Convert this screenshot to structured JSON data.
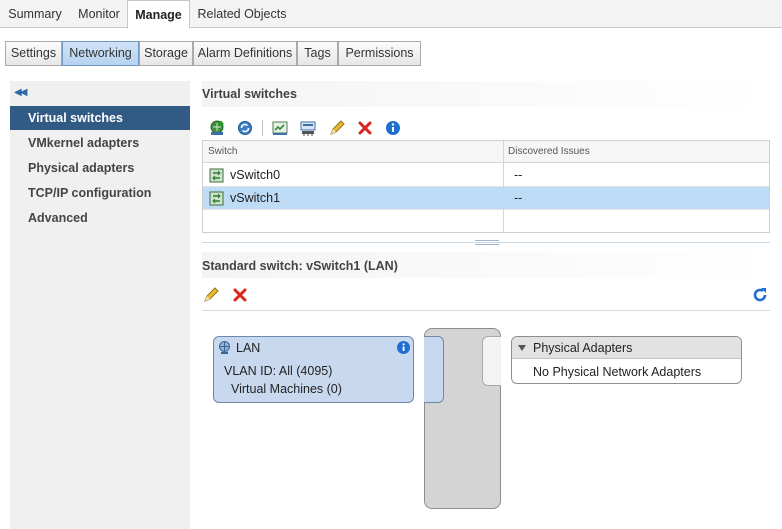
{
  "top_tabs": [
    "Summary",
    "Monitor",
    "Manage",
    "Related Objects"
  ],
  "sub_tabs": [
    "Settings",
    "Networking",
    "Storage",
    "Alarm Definitions",
    "Tags",
    "Permissions"
  ],
  "nav": {
    "collapse_glyph": "◀◀",
    "items": [
      "Virtual switches",
      "VMkernel adapters",
      "Physical adapters",
      "TCP/IP configuration",
      "Advanced"
    ]
  },
  "virtual_switches": {
    "title": "Virtual switches",
    "columns": [
      "Switch",
      "Discovered Issues"
    ],
    "rows": [
      {
        "switch": "vSwitch0",
        "issues": "--"
      },
      {
        "switch": "vSwitch1",
        "issues": "--"
      }
    ]
  },
  "detail": {
    "title": "Standard switch: vSwitch1 (LAN)",
    "portgroup": {
      "name": "LAN",
      "vlan": "VLAN ID: All (4095)",
      "vms": "Virtual Machines (0)"
    },
    "physical": {
      "header": "Physical Adapters",
      "empty": "No Physical Network Adapters"
    }
  },
  "colors": {
    "nav_active": "#315a84",
    "row_selected": "#bfdcf7",
    "portgroup_fill": "#c8d9ef",
    "subtab_active": "#b5d3f1",
    "delete_red": "#d9261c",
    "info_blue": "#1f6fd1"
  }
}
